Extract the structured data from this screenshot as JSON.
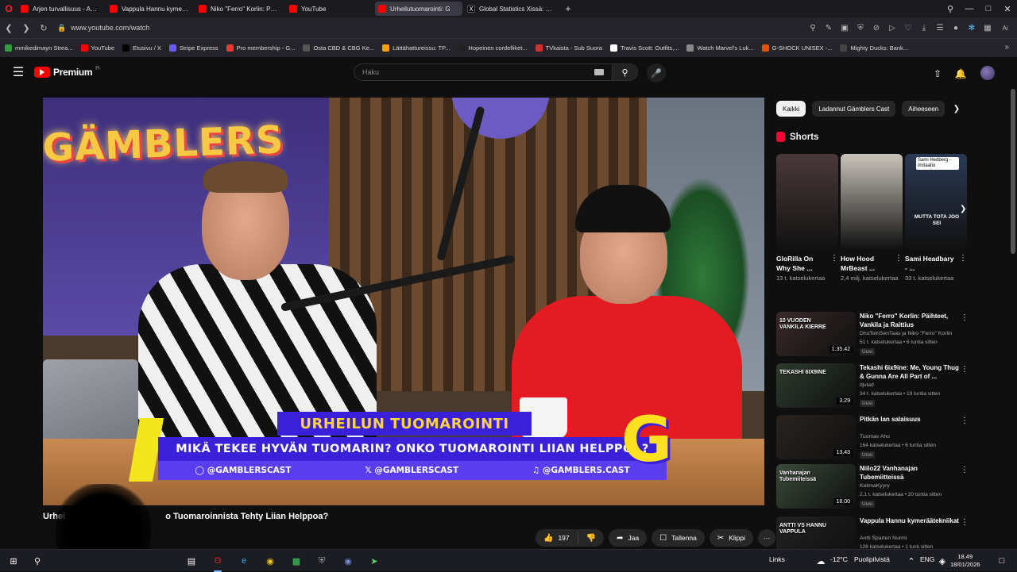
{
  "browser": {
    "tabs": [
      {
        "label": "Arjen turvallisuus - Antti R",
        "favicon": "youtube-icon",
        "active": false
      },
      {
        "label": "Vappula Hannu kymeräät",
        "favicon": "youtube-icon",
        "active": false
      },
      {
        "label": "Niko \"Ferro\" Korlin: Päiht",
        "favicon": "youtube-icon",
        "active": false
      },
      {
        "label": "YouTube",
        "favicon": "youtube-icon",
        "active": false
      },
      {
        "label": "Urheilutuomarointi: G",
        "favicon": "youtube-icon",
        "active": true
      },
      {
        "label": "Global Statistics Xissä: \"10",
        "favicon": "x-icon",
        "active": false
      }
    ],
    "url": "www.youtube.com/watch",
    "ai_button": "Ai",
    "bookmarks": [
      {
        "label": "mmikedimayn Strea...",
        "color": "#2e9e3f"
      },
      {
        "label": "YouTube",
        "color": "#ff0000"
      },
      {
        "label": "Etusivu / X",
        "color": "#000000"
      },
      {
        "label": "Stripe Express",
        "color": "#635bff"
      },
      {
        "label": "Pro membership - G...",
        "color": "#e53935"
      },
      {
        "label": "Osta CBD & CBG Ke...",
        "color": "#555555"
      },
      {
        "label": "Lättähattureissu: TP...",
        "color": "#f4a300"
      },
      {
        "label": "Hopeinen cordelliket...",
        "color": "#222222"
      },
      {
        "label": "TVkaista - Sub Suora",
        "color": "#d32f2f"
      },
      {
        "label": "Travis Scott: Outfits,...",
        "color": "#ffffff"
      },
      {
        "label": "Watch Marvel's Luk...",
        "color": "#888888"
      },
      {
        "label": "G-SHOCK UNISEX -...",
        "color": "#e65100"
      },
      {
        "label": "Mighty Ducks: Bank...",
        "color": "#444444"
      }
    ]
  },
  "youtube": {
    "brand": "Premium",
    "region": "FI",
    "search_placeholder": "Haku",
    "video": {
      "overlay_title": "URHEILUN TUOMAROINTI",
      "overlay_subtitle": "MIKÄ TEKEE HYVÄN TUOMARIN? ONKO TUOMAROINTI LIIAN HELPPOA?",
      "social_instagram": "@GAMBLERSCAST",
      "social_x": "@GAMBLERSCAST",
      "social_tiktok": "@GAMBLERS.CAST",
      "sign_text": "GÄMBLERS",
      "logo_letter": "G"
    },
    "title_start": "Urhei",
    "title": "o Tuomaroinnista Tehty Liian Helppoa?",
    "actions": {
      "likes": "197",
      "share": "Jaa",
      "save": "Tallenna",
      "clip": "Klippi"
    },
    "chips": [
      {
        "label": "Kaikki",
        "active": true
      },
      {
        "label": "Ladannut Gämblers Cast",
        "active": false
      },
      {
        "label": "Aiheeseen",
        "active": false
      }
    ],
    "shorts_heading": "Shorts",
    "shorts": [
      {
        "title": "GloRilla On Why She ...",
        "views": "13 t. katselukertaa",
        "bg": "#4a3a3a"
      },
      {
        "title": "How Hood MrBeast ...",
        "views": "2,4 milj. katselukertaa",
        "bg": "#c9c4bb"
      },
      {
        "title": "Sami Headbary - ...",
        "views": "33 t. katselukertaa",
        "bg": "#2b3a55",
        "overlay_top": "Sami Hedberg -imitaatio",
        "overlay_mid": "MUTTA TOTA JOO SEI"
      }
    ],
    "recommended": [
      {
        "title": "Niko \"Ferro\" Korlin: Päihteet, Vankila ja Raittius",
        "channel": "DhoTeinSenTaas ja Niko \"Ferro\" Korlin",
        "meta": "51 t. katselukertaa • 6 tuntia sitten",
        "badge": "Uusi",
        "duration": "1.35.42",
        "thumb_text": "10 VUODEN VANKILA KIERRE",
        "bg": "#3a2a2a"
      },
      {
        "title": "Tekashi 6ix9ine: Me, Young Thug & Gunna Are All Part of ...",
        "channel": "djvlad",
        "meta": "34 t. katselukertaa • 19 tuntia sitten",
        "badge": "Uusi",
        "duration": "3.29",
        "thumb_text": "TEKASHI 6IX9INE",
        "bg": "#2e3b2e"
      },
      {
        "title": "Pitkän lan salaisuus",
        "channel": "Tuomas Aho",
        "meta": "164 katselukertaa • 6 tuntia sitten",
        "badge": "Uusi",
        "duration": "13.43",
        "thumb_text": "",
        "bg": "#2a2420"
      },
      {
        "title": "Niilo22 Vanhanajan Tubemiitteissä",
        "channel": "KalimaKyyry",
        "meta": "2,1 t. katselukertaa • 20 tuntia sitten",
        "badge": "Uusi",
        "duration": "18.00",
        "thumb_text": "Vanhanajan Tubemiiteissä",
        "bg": "#3a4a3a"
      },
      {
        "title": "Vappula Hannu kymeräätekniikat",
        "channel": "Antti Sparten Nurmi",
        "meta": "126 katselukertaa • 1 tunti sitten",
        "badge": "",
        "duration": "",
        "thumb_text": "ANTTI VS HANNU VAPPULA",
        "bg": "#222222"
      }
    ]
  },
  "taskbar": {
    "links_label": "Links",
    "weather": "-12°C",
    "weather_desc": "Puolipilvistä",
    "language": "ENG",
    "time": "18.49",
    "date": "18/01/2026"
  }
}
